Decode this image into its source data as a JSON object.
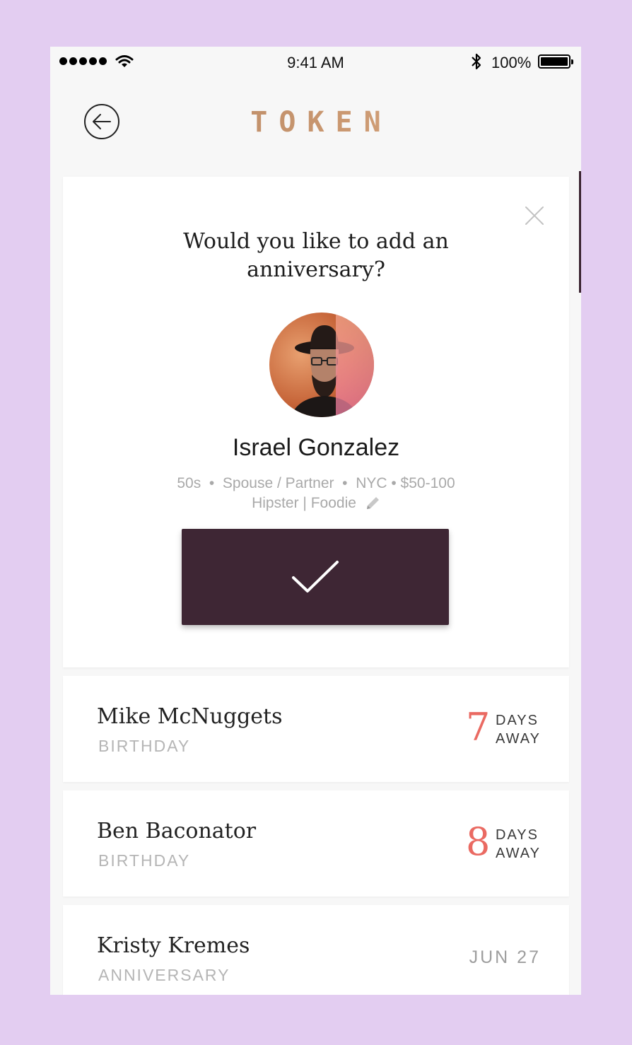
{
  "status_bar": {
    "time": "9:41 AM",
    "battery": "100%"
  },
  "header": {
    "logo": "TOKEN"
  },
  "prompt": {
    "title": "Would you like to add an anniversary?",
    "person": {
      "name": "Israel Gonzalez",
      "meta_line1": "50s  •  Spouse / Partner  •  NYC • $50-100",
      "meta_line2": "Hipster | Foodie"
    }
  },
  "events": [
    {
      "name": "Mike McNuggets",
      "type": "BIRTHDAY",
      "days": "7",
      "days_label_1": "DAYS",
      "days_label_2": "AWAY"
    },
    {
      "name": "Ben Baconator",
      "type": "BIRTHDAY",
      "days": "8",
      "days_label_1": "DAYS",
      "days_label_2": "AWAY"
    },
    {
      "name": "Kristy Kremes",
      "type": "ANNIVERSARY",
      "date": "JUN 27"
    }
  ],
  "colors": {
    "background": "#e3cdf1",
    "accent": "#3e2634",
    "days_count": "#ea6a62",
    "logo_gold": "#c7956e"
  }
}
